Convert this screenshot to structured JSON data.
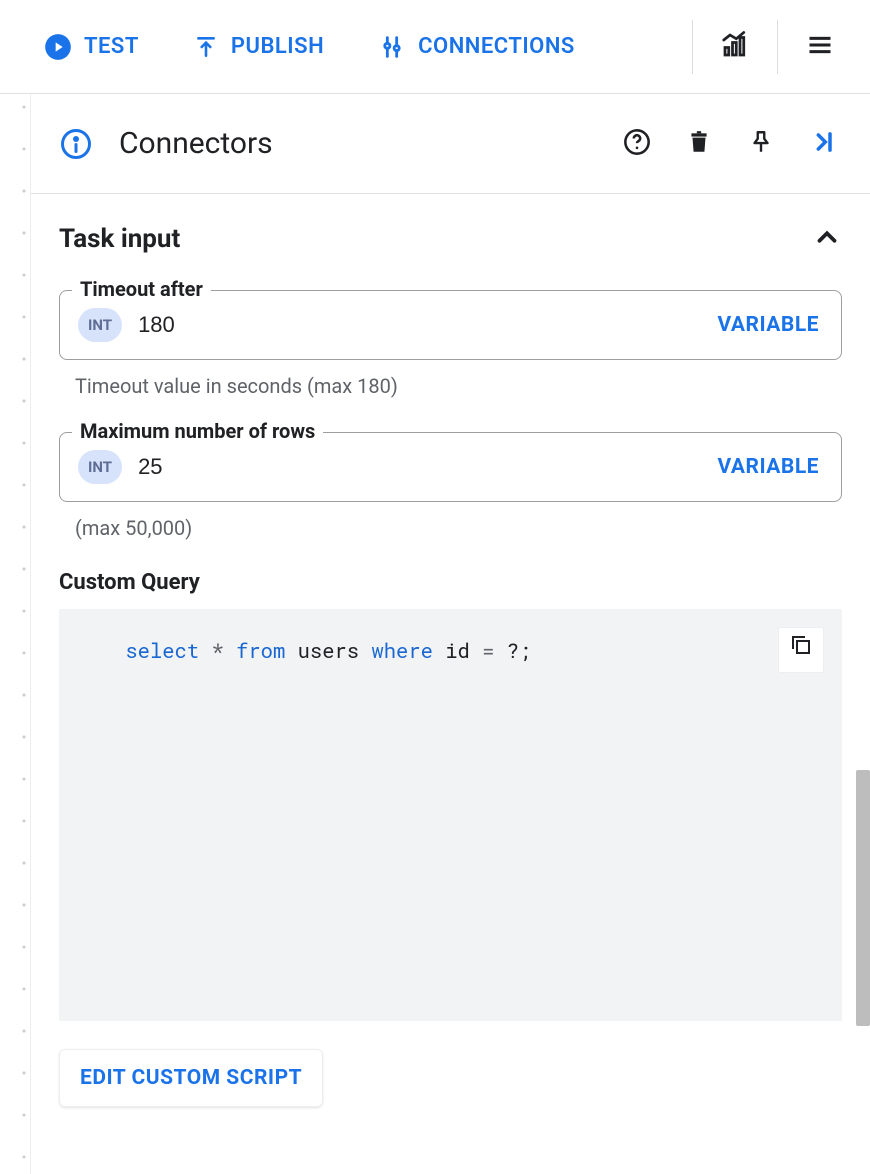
{
  "toolbar": {
    "test_label": "TEST",
    "publish_label": "PUBLISH",
    "connections_label": "CONNECTIONS"
  },
  "panel": {
    "title": "Connectors",
    "section_title": "Task input",
    "timeout": {
      "legend": "Timeout after",
      "chip": "INT",
      "value": "180",
      "variable_label": "VARIABLE",
      "helper": "Timeout value in seconds (max 180)"
    },
    "maxrows": {
      "legend": "Maximum number of rows",
      "chip": "INT",
      "value": "25",
      "variable_label": "VARIABLE",
      "helper": "(max 50,000)"
    },
    "custom_query": {
      "label": "Custom Query",
      "tokens": {
        "select": "select",
        "star": "*",
        "from": "from",
        "users": "users",
        "where": "where",
        "id": "id",
        "eq": "=",
        "q": "?;"
      }
    },
    "edit_script_label": "EDIT CUSTOM SCRIPT"
  }
}
